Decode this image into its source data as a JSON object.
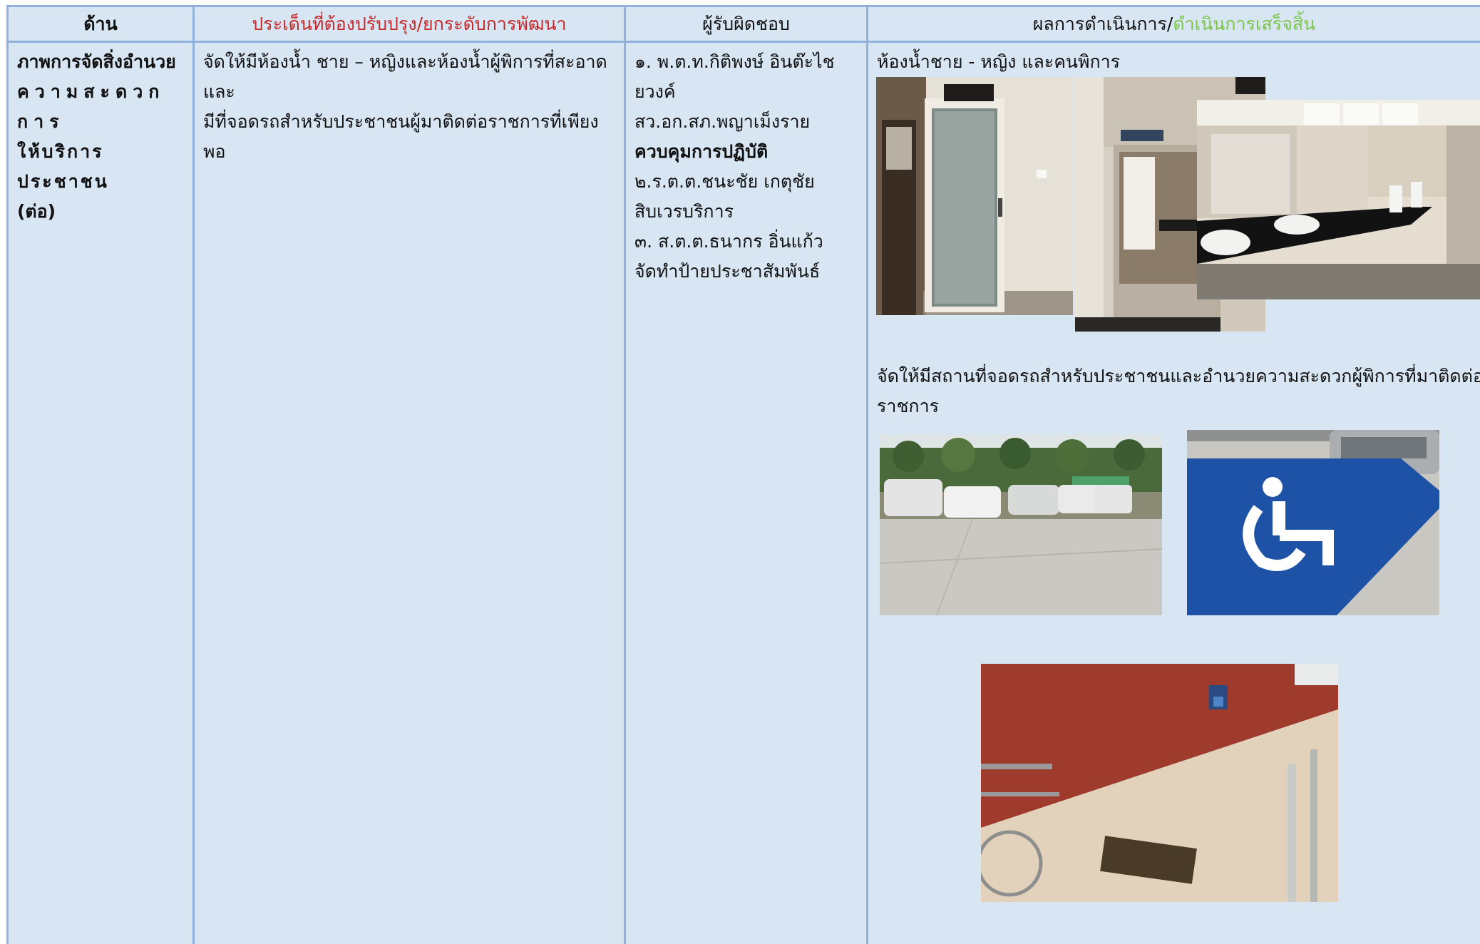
{
  "table": {
    "headers": {
      "area": "ด้าน",
      "issue": "ประเด็นที่ต้องปรับปรุง/ยกระดับการพัฒนา",
      "responsible": "ผู้รับผิดชอบ",
      "result_prefix": "ผลการดำเนินการ/",
      "result_status": "ดำเนินการเสร็จสิ้น"
    },
    "row": {
      "area_lines": [
        "ภาพการจัดสิ่งอำนวย",
        "ความสะดวกการ",
        "ให้บริการประชาชน",
        "(ต่อ)"
      ],
      "issue_lines": [
        "จัดให้มีห้องน้ำ ชาย – หญิงและห้องน้ำผู้พิการที่สะอาดและ",
        "มีที่จอดรถสำหรับประชาชนผู้มาติดต่อราชการที่เพียงพอ"
      ],
      "responsible_lines": [
        "๑. พ.ต.ท.กิติพงษ์ อินต๊ะไชยวงค์",
        "สว.อก.สภ.พญาเม็งราย",
        "ควบคุมการปฏิบัติ",
        "๒.ร.ต.ต.ชนะชัย   เกตุชัย",
        "สิบเวรบริการ",
        "๓. ส.ต.ต.ธนากร อิ่นแก้ว",
        "จัดทำป้ายประชาสัมพันธ์"
      ],
      "result": {
        "caption1": "ห้องน้ำชาย - หญิง และคนพิการ",
        "caption2_line1": "จัดให้มีสถานที่จอดรถสำหรับประชาชนและอำนวยความสะดวกผู้พิการที่มาติดต่อ",
        "caption2_line2": "ราชการ"
      }
    }
  },
  "colors": {
    "cell_background": "#d8e6f4",
    "grid_line": "#8fb1dc",
    "issue_header": "#c62828",
    "status_header": "#7ec64a"
  }
}
